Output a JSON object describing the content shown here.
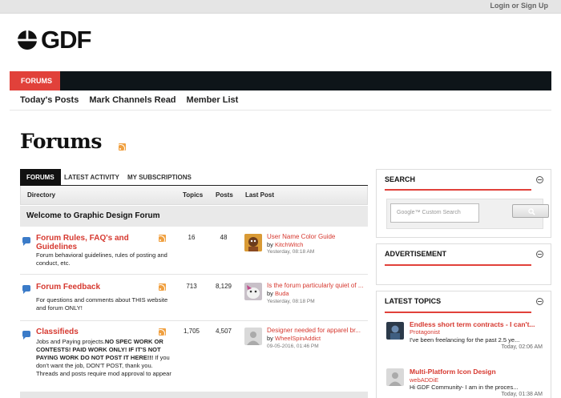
{
  "header": {
    "login_label": "Login or Sign Up",
    "logo_text": "GDF"
  },
  "nav": {
    "active_tab": "FORUMS"
  },
  "subnav": {
    "items": [
      "Today's Posts",
      "Mark Channels Read",
      "Member List"
    ]
  },
  "page": {
    "title": "Forums"
  },
  "tabs": [
    "FORUMS",
    "LATEST ACTIVITY",
    "MY SUBSCRIPTIONS"
  ],
  "table": {
    "headers": {
      "directory": "Directory",
      "topics": "Topics",
      "posts": "Posts",
      "last_post": "Last Post"
    },
    "section": "Welcome to Graphic Design Forum",
    "forums": [
      {
        "title": "Forum Rules, FAQ's and Guidelines",
        "desc": "Forum behavioral guidelines, rules of posting and conduct, etc.",
        "topics": "16",
        "posts": "48",
        "last_title": "User Name Color Guide",
        "last_by_prefix": "by",
        "last_by": "KitchWitch",
        "last_time": "Yesterday, 08:18 AM"
      },
      {
        "title": "Forum Feedback",
        "desc": "For questions and comments about THIS website and forum ONLY!",
        "topics": "713",
        "posts": "8,129",
        "last_title": "Is the forum particularly quiet of ...",
        "last_by_prefix": "by",
        "last_by": "Buda",
        "last_time": "Yesterday, 08:18 PM"
      },
      {
        "title": "Classifieds",
        "desc_plain": "Jobs and Paying projects.",
        "desc_bold": "NO SPEC WORK OR CONTESTS! PAID WORK ONLY! IF IT'S NOT PAYING WORK DO NOT POST IT HERE!!!",
        "desc_tail": " If you don't want the job, DON'T POST, thank you. Threads and posts require mod approval to appear",
        "topics": "1,705",
        "posts": "4,507",
        "last_title": "Designer needed for apparel br...",
        "last_by_prefix": "by",
        "last_by": "WheelSpinAddict",
        "last_time": "09-05-2016, 01:46 PM"
      }
    ]
  },
  "sidebar": {
    "search": {
      "title": "SEARCH",
      "placeholder": "Google™ Custom Search"
    },
    "ad": {
      "title": "ADVERTISEMENT"
    },
    "latest": {
      "title": "LATEST TOPICS",
      "topics": [
        {
          "title": "Endless short term contracts - I can't...",
          "author": "Protagonist",
          "snippet": "I've been freelancing for the past 2.5 ye...",
          "time": "Today, 02:06 AM"
        },
        {
          "title": "Multi-Platform Icon Design",
          "author": "webADDiE",
          "snippet": "Hi GDF Community- I am in the proces...",
          "time": "Today, 01:38 AM"
        }
      ]
    }
  },
  "colors": {
    "accent": "#e1413a",
    "link": "#d6382f",
    "navbar": "#0e1519",
    "bubble": "#3b7bc8"
  }
}
